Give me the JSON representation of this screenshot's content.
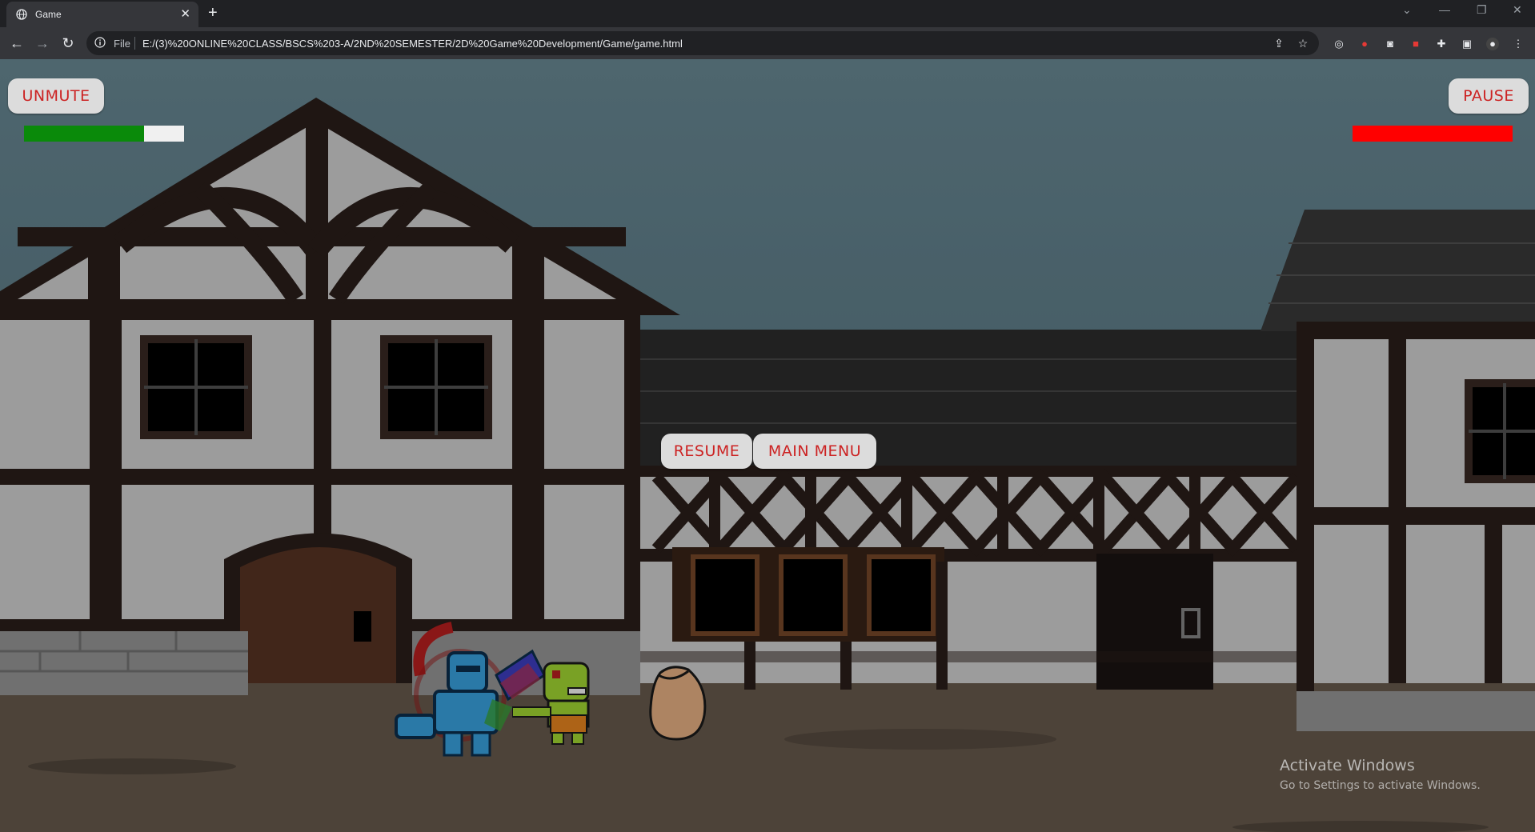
{
  "browser": {
    "tab_title": "Game",
    "address_scheme": "File",
    "address_url": "E:/(3)%20ONLINE%20CLASS/BSCS%203-A/2ND%20SEMESTER/2D%20Game%20Development/Game/game.html"
  },
  "game": {
    "unmute_label": "UNMUTE",
    "pause_label": "PAUSE",
    "resume_label": "RESUME",
    "main_menu_label": "MAIN MENU",
    "player_health_fraction": 0.75,
    "enemy_health_fraction": 1.0,
    "player_health_color": "#0a8a0a",
    "enemy_health_color": "#ff0000",
    "button_text_color": "#cc2222"
  },
  "watermark": {
    "title": "Activate Windows",
    "subtitle": "Go to Settings to activate Windows."
  }
}
